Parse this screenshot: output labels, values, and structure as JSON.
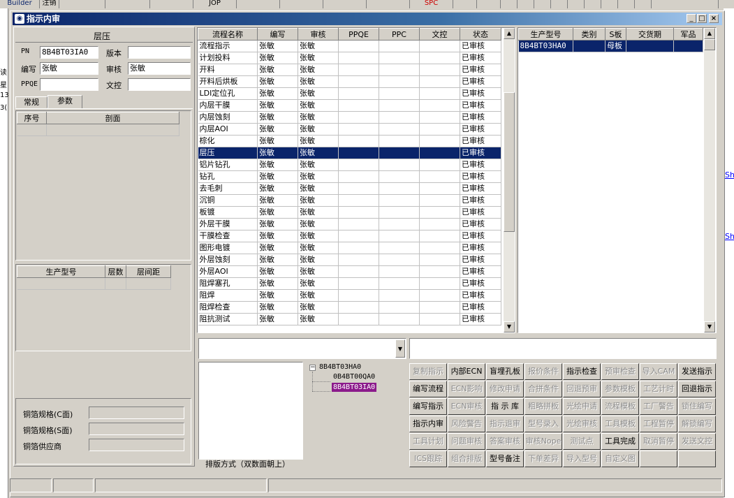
{
  "toolbar": {
    "items": [
      "Builder",
      "注销",
      "",
      "",
      "",
      "JOP",
      "",
      "",
      "",
      "",
      "SPC",
      "",
      "",
      "",
      "",
      "",
      "",
      "",
      "",
      "",
      "",
      "",
      ""
    ]
  },
  "window": {
    "title": "指示内审",
    "min": "_",
    "max": "□",
    "close": "×"
  },
  "left_panel": {
    "section_title": "层压",
    "pn_label": "PN",
    "pn_value": "8B4BT03IA0",
    "version_label": "版本",
    "version_value": "",
    "author_label": "编写",
    "author_value": "张敏",
    "review_label": "审核",
    "review_value": "张敏",
    "ppqe_label": "PPQE",
    "ppqe_value": "",
    "doc_label": "文控",
    "doc_value": "",
    "tabs": [
      "常规",
      "参数"
    ],
    "param_headers": [
      "序号",
      "剖面"
    ],
    "model_headers": [
      "生产型号",
      "层数",
      "层间距"
    ],
    "foil_c_label": "铜箔规格(C面)",
    "foil_s_label": "铜箔规格(S面)",
    "foil_supplier_label": "铜箔供应商"
  },
  "process_table": {
    "headers": [
      "流程名称",
      "编写",
      "审核",
      "PPQE",
      "PPC",
      "文控",
      "状态"
    ],
    "selected_index": 9,
    "rows": [
      [
        "流程指示",
        "张敏",
        "张敏",
        "",
        "",
        "",
        "已审核"
      ],
      [
        "计划投料",
        "张敏",
        "张敏",
        "",
        "",
        "",
        "已审核"
      ],
      [
        "开料",
        "张敏",
        "张敏",
        "",
        "",
        "",
        "已审核"
      ],
      [
        "开料后烘板",
        "张敏",
        "张敏",
        "",
        "",
        "",
        "已审核"
      ],
      [
        "LDI定位孔",
        "张敏",
        "张敏",
        "",
        "",
        "",
        "已审核"
      ],
      [
        "内层干膜",
        "张敏",
        "张敏",
        "",
        "",
        "",
        "已审核"
      ],
      [
        "内层蚀刻",
        "张敏",
        "张敏",
        "",
        "",
        "",
        "已审核"
      ],
      [
        "内层AOI",
        "张敏",
        "张敏",
        "",
        "",
        "",
        "已审核"
      ],
      [
        "棕化",
        "张敏",
        "张敏",
        "",
        "",
        "",
        "已审核"
      ],
      [
        "层压",
        "张敏",
        "张敏",
        "",
        "",
        "",
        "已审核"
      ],
      [
        "铝片钻孔",
        "张敏",
        "张敏",
        "",
        "",
        "",
        "已审核"
      ],
      [
        "钻孔",
        "张敏",
        "张敏",
        "",
        "",
        "",
        "已审核"
      ],
      [
        "去毛刺",
        "张敏",
        "张敏",
        "",
        "",
        "",
        "已审核"
      ],
      [
        "沉铜",
        "张敏",
        "张敏",
        "",
        "",
        "",
        "已审核"
      ],
      [
        "板镀",
        "张敏",
        "张敏",
        "",
        "",
        "",
        "已审核"
      ],
      [
        "外层干膜",
        "张敏",
        "张敏",
        "",
        "",
        "",
        "已审核"
      ],
      [
        "干膜检查",
        "张敏",
        "张敏",
        "",
        "",
        "",
        "已审核"
      ],
      [
        "图形电镀",
        "张敏",
        "张敏",
        "",
        "",
        "",
        "已审核"
      ],
      [
        "外层蚀刻",
        "张敏",
        "张敏",
        "",
        "",
        "",
        "已审核"
      ],
      [
        "外层AOI",
        "张敏",
        "张敏",
        "",
        "",
        "",
        "已审核"
      ],
      [
        "阻焊塞孔",
        "张敏",
        "张敏",
        "",
        "",
        "",
        "已审核"
      ],
      [
        "阻焊",
        "张敏",
        "张敏",
        "",
        "",
        "",
        "已审核"
      ],
      [
        "阻焊检查",
        "张敏",
        "张敏",
        "",
        "",
        "",
        "已审核"
      ],
      [
        "阻抗测试",
        "张敏",
        "张敏",
        "",
        "",
        "",
        "已审核"
      ]
    ]
  },
  "model_table": {
    "headers": [
      "生产型号",
      "类别",
      "S板",
      "交货期",
      "军品"
    ],
    "rows": [
      [
        "8B4BT03HA0",
        "",
        "母板",
        "",
        ""
      ]
    ]
  },
  "tree": {
    "root": "8B4BT03HA0",
    "children": [
      "0B4BT00QA0",
      "8B4BT03IA0"
    ],
    "selected_child": 1
  },
  "layout_mode_label": "排版方式（双数面朝上）",
  "actions": [
    [
      {
        "label": "复制指示",
        "enabled": false
      },
      {
        "label": "内部ECN",
        "enabled": true
      },
      {
        "label": "盲埋孔板",
        "enabled": true
      },
      {
        "label": "报价条件",
        "enabled": false
      },
      {
        "label": "指示检查",
        "enabled": true
      },
      {
        "label": "预审检查",
        "enabled": false
      },
      {
        "label": "导入CAM",
        "enabled": false
      },
      {
        "label": "发送指示",
        "enabled": true
      }
    ],
    [
      {
        "label": "编写流程",
        "enabled": true
      },
      {
        "label": "ECN影响",
        "enabled": false
      },
      {
        "label": "修改申请",
        "enabled": false
      },
      {
        "label": "合拼条件",
        "enabled": false
      },
      {
        "label": "回退预审",
        "enabled": false
      },
      {
        "label": "参数模板",
        "enabled": false
      },
      {
        "label": "工艺计时",
        "enabled": false
      },
      {
        "label": "回退指示",
        "enabled": true
      }
    ],
    [
      {
        "label": "编写指示",
        "enabled": true
      },
      {
        "label": "ECN审核",
        "enabled": false
      },
      {
        "label": "指 示 库",
        "enabled": true
      },
      {
        "label": "粗略拼板",
        "enabled": false
      },
      {
        "label": "光绘申请",
        "enabled": false
      },
      {
        "label": "流程模板",
        "enabled": false
      },
      {
        "label": "工厂警告",
        "enabled": false
      },
      {
        "label": "锁住编写",
        "enabled": false
      }
    ],
    [
      {
        "label": "指示内审",
        "enabled": true
      },
      {
        "label": "风险警告",
        "enabled": false
      },
      {
        "label": "指示退审",
        "enabled": false
      },
      {
        "label": "型号录入",
        "enabled": false
      },
      {
        "label": "光绘审核",
        "enabled": false
      },
      {
        "label": "工具模板",
        "enabled": false
      },
      {
        "label": "工程暂停",
        "enabled": false
      },
      {
        "label": "解锁编写",
        "enabled": false
      }
    ],
    [
      {
        "label": "工具计划",
        "enabled": false
      },
      {
        "label": "问题审核",
        "enabled": false
      },
      {
        "label": "答案审核",
        "enabled": false
      },
      {
        "label": "审核Nope",
        "enabled": false
      },
      {
        "label": "测试点",
        "enabled": false
      },
      {
        "label": "工具完成",
        "enabled": true
      },
      {
        "label": "取消暂停",
        "enabled": false
      },
      {
        "label": "发送文控",
        "enabled": false
      }
    ],
    [
      {
        "label": "ICS跟踪",
        "enabled": false
      },
      {
        "label": "组合排版",
        "enabled": false
      },
      {
        "label": "型号备注",
        "enabled": true
      },
      {
        "label": "下单差异",
        "enabled": false
      },
      {
        "label": "导入型号",
        "enabled": false
      },
      {
        "label": "自定义图",
        "enabled": false
      },
      {
        "label": "",
        "enabled": false
      },
      {
        "label": "",
        "enabled": false
      }
    ]
  ],
  "side_links": [
    "Sh",
    "Sh"
  ],
  "left_edge_text": [
    "读",
    "星",
    "13",
    "3("
  ]
}
